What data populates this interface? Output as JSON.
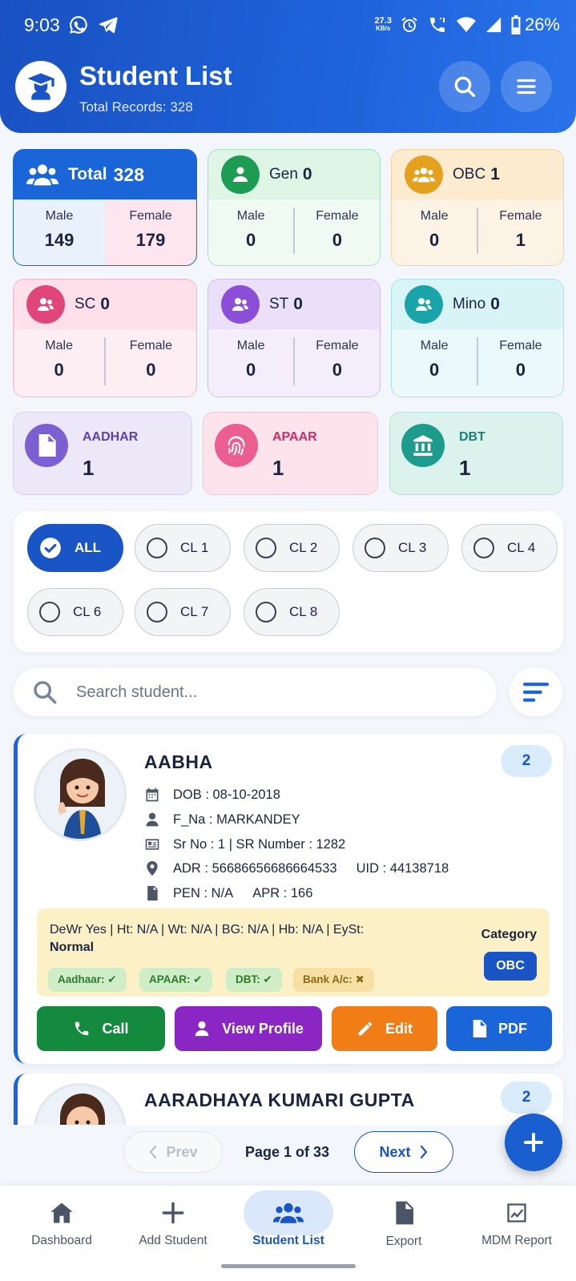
{
  "status_bar": {
    "time": "9:03",
    "net_speed_value": "27.3",
    "net_speed_unit": "KB/s",
    "battery": "26%"
  },
  "header": {
    "title": "Student List",
    "subtitle": "Total Records: 328"
  },
  "summary_cards": [
    {
      "label": "Total",
      "count": "328",
      "male_label": "Male",
      "female_label": "Female",
      "male": "149",
      "female": "179"
    },
    {
      "label": "Gen",
      "count": "0",
      "male_label": "Male",
      "female_label": "Female",
      "male": "0",
      "female": "0"
    },
    {
      "label": "OBC",
      "count": "1",
      "male_label": "Male",
      "female_label": "Female",
      "male": "0",
      "female": "1"
    },
    {
      "label": "SC",
      "count": "0",
      "male_label": "Male",
      "female_label": "Female",
      "male": "0",
      "female": "0"
    },
    {
      "label": "ST",
      "count": "0",
      "male_label": "Male",
      "female_label": "Female",
      "male": "0",
      "female": "0"
    },
    {
      "label": "Mino",
      "count": "0",
      "male_label": "Male",
      "female_label": "Female",
      "male": "0",
      "female": "0"
    }
  ],
  "doc_cards": [
    {
      "label": "AADHAR",
      "value": "1",
      "color": "#5b3fb5"
    },
    {
      "label": "APAAR",
      "value": "1",
      "color": "#d12a66"
    },
    {
      "label": "DBT",
      "value": "1",
      "color": "#1b7f76"
    }
  ],
  "class_filters": [
    "ALL",
    "CL 1",
    "CL 2",
    "CL 3",
    "CL 4",
    "CL 6",
    "CL 7",
    "CL 8"
  ],
  "selected_filter": "ALL",
  "search": {
    "placeholder": "Search student..."
  },
  "students": [
    {
      "name": "AABHA",
      "badge": "2",
      "dob": "DOB : 08-10-2018",
      "father": "F_Na : MARKANDEY",
      "sr": "Sr No : 1 | SR Number : 1282",
      "adr": "ADR : 56686656686664533",
      "uid": "UID : 44138718",
      "pen": "PEN : N/A",
      "apr": "APR : 166",
      "health": "DeWr Yes | Ht: N/A | Wt: N/A | BG: N/A | Hb: N/A | EySt:",
      "health_status": "Normal",
      "tags": {
        "aadhaar": "Aadhaar: ✔",
        "apaar": "APAAR: ✔",
        "dbt": "DBT: ✔",
        "bank": "Bank A/c: ✖"
      },
      "category_label": "Category",
      "category": "OBC",
      "actions": {
        "call": "Call",
        "view": "View Profile",
        "edit": "Edit",
        "pdf": "PDF"
      }
    },
    {
      "name": "AARADHAYA KUMARI GUPTA",
      "badge": "2"
    }
  ],
  "pagination": {
    "prev": "Prev",
    "page_label": "Page 1 of 33",
    "next": "Next"
  },
  "bottom_nav": [
    {
      "label": "Dashboard",
      "icon": "home-icon"
    },
    {
      "label": "Add Student",
      "icon": "plus-icon"
    },
    {
      "label": "Student List",
      "icon": "users-icon",
      "active": true
    },
    {
      "label": "Export",
      "icon": "document-icon"
    },
    {
      "label": "MDM Report",
      "icon": "chart-icon"
    }
  ],
  "colors": {
    "primary": "#1a55c5",
    "call": "#138a3d",
    "view": "#8a27c4",
    "edit": "#f07d16",
    "pdf": "#1a66d9"
  }
}
